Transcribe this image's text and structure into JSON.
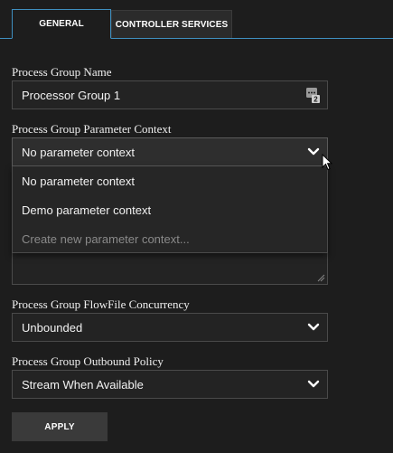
{
  "tabs": [
    {
      "label": "GENERAL",
      "active": true
    },
    {
      "label": "CONTROLLER SERVICES",
      "active": false
    }
  ],
  "form": {
    "name_label": "Process Group Name",
    "name_value": "Processor Group 1",
    "name_icon": "parameter-reference-icon",
    "param_context_label": "Process Group Parameter Context",
    "param_context_value": "No parameter context",
    "param_context_options": [
      "No parameter context",
      "Demo parameter context",
      "Create new parameter context..."
    ],
    "concurrency_label": "Process Group FlowFile Concurrency",
    "concurrency_value": "Unbounded",
    "outbound_label": "Process Group Outbound Policy",
    "outbound_value": "Stream When Available",
    "apply_label": "APPLY"
  },
  "colors": {
    "background": "#1d1d1d",
    "active_tab_border": "#3f8fbf",
    "field_bg": "#232323",
    "button_bg": "#3a3a3a"
  }
}
